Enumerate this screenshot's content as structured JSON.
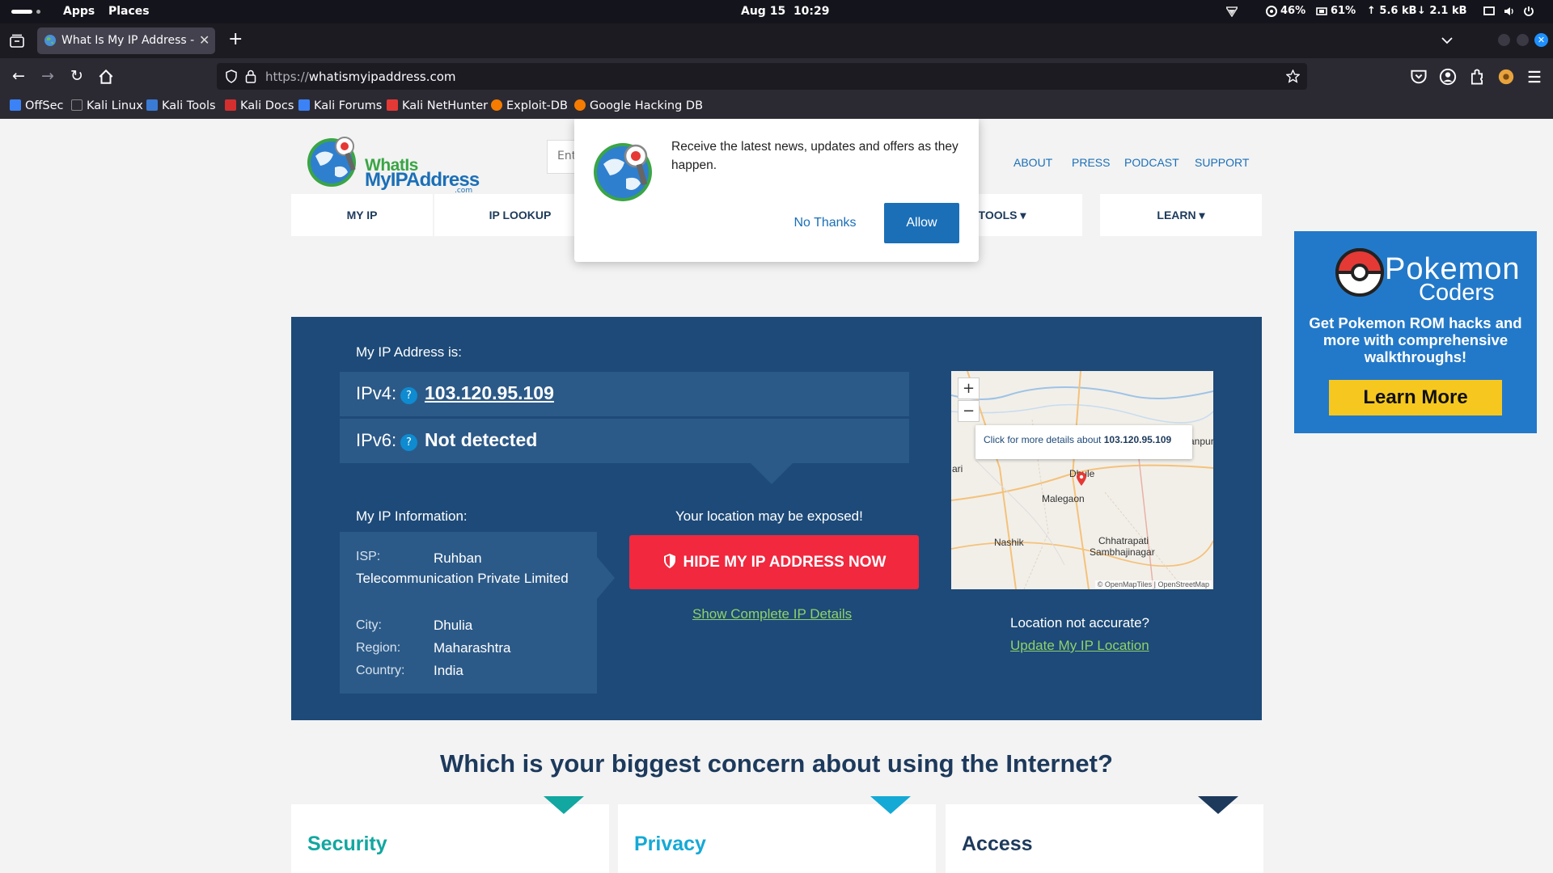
{
  "os_panel": {
    "apps": "Apps",
    "places": "Places",
    "date": "Aug 15",
    "time": "10:29",
    "cpu": "46%",
    "mem": "61%",
    "up": "↑ 5.6 kB",
    "down": "↓ 2.1 kB"
  },
  "browser": {
    "tab_title": "What Is My IP Address - S",
    "url_proto": "https://",
    "url_host": "whatismyipaddress.com",
    "bookmarks": [
      "OffSec",
      "Kali Linux",
      "Kali Tools",
      "Kali Docs",
      "Kali Forums",
      "Kali NetHunter",
      "Exploit-DB",
      "Google Hacking DB"
    ]
  },
  "header": {
    "logo_line1": "WhatIs",
    "logo_line2": "MyIPAddress",
    "logo_line3": ".com",
    "search_placeholder": "Ent",
    "links": [
      "ABOUT",
      "PRESS",
      "PODCAST",
      "SUPPORT"
    ]
  },
  "nav": {
    "items": [
      "MY IP",
      "IP LOOKUP",
      "TOOLS ▾",
      "LEARN ▾"
    ]
  },
  "notification": {
    "message": "Receive the latest news, updates and offers as they happen.",
    "no_label": "No Thanks",
    "allow_label": "Allow"
  },
  "ip_panel": {
    "my_ip_label": "My IP Address is:",
    "ipv4_label": "IPv4:",
    "ipv4_value": "103.120.95.109",
    "ipv6_label": "IPv6:",
    "ipv6_value": "Not detected",
    "qmark": "?",
    "info_label": "My IP Information:",
    "isp_label": "ISP:",
    "isp_value": "Ruhban Telecommunication Private Limited",
    "city_label": "City:",
    "city_value": "Dhulia",
    "region_label": "Region:",
    "region_value": "Maharashtra",
    "country_label": "Country:",
    "country_value": "India",
    "exposed_text": "Your location may be exposed!",
    "hide_button": "HIDE MY IP ADDRESS NOW",
    "details_link": "Show Complete IP Details",
    "not_accurate": "Location not accurate?",
    "update_link": "Update My IP Location"
  },
  "map": {
    "popup_prefix": "Click for more details about",
    "popup_ip": "103.120.95.109",
    "zoom_in": "+",
    "zoom_out": "−",
    "labels": [
      "anpur",
      "ari",
      "Dhule",
      "Malegaon",
      "Nashik",
      "Chhatrapati",
      "Sambhajinagar"
    ],
    "attribution": "© OpenMapTiles | OpenStreetMap"
  },
  "concern": {
    "title": "Which is your biggest concern about using the Internet?",
    "cards": [
      {
        "title": "Security",
        "color": "#12a7a0"
      },
      {
        "title": "Privacy",
        "color": "#15a9d6"
      },
      {
        "title": "Access",
        "color": "#1d3a5c"
      }
    ]
  },
  "ad": {
    "brand1": "Pokemon",
    "brand2": "Coders",
    "text": "Get Pokemon ROM hacks and more with comprehensive walkthroughs!",
    "button": "Learn More"
  },
  "colors": {
    "panel_bg": "#1d4a78",
    "panel_row": "#2c5a88",
    "hide_btn": "#f1283e",
    "link_green": "#8fd16a",
    "brand_blue": "#1b6fb7"
  }
}
